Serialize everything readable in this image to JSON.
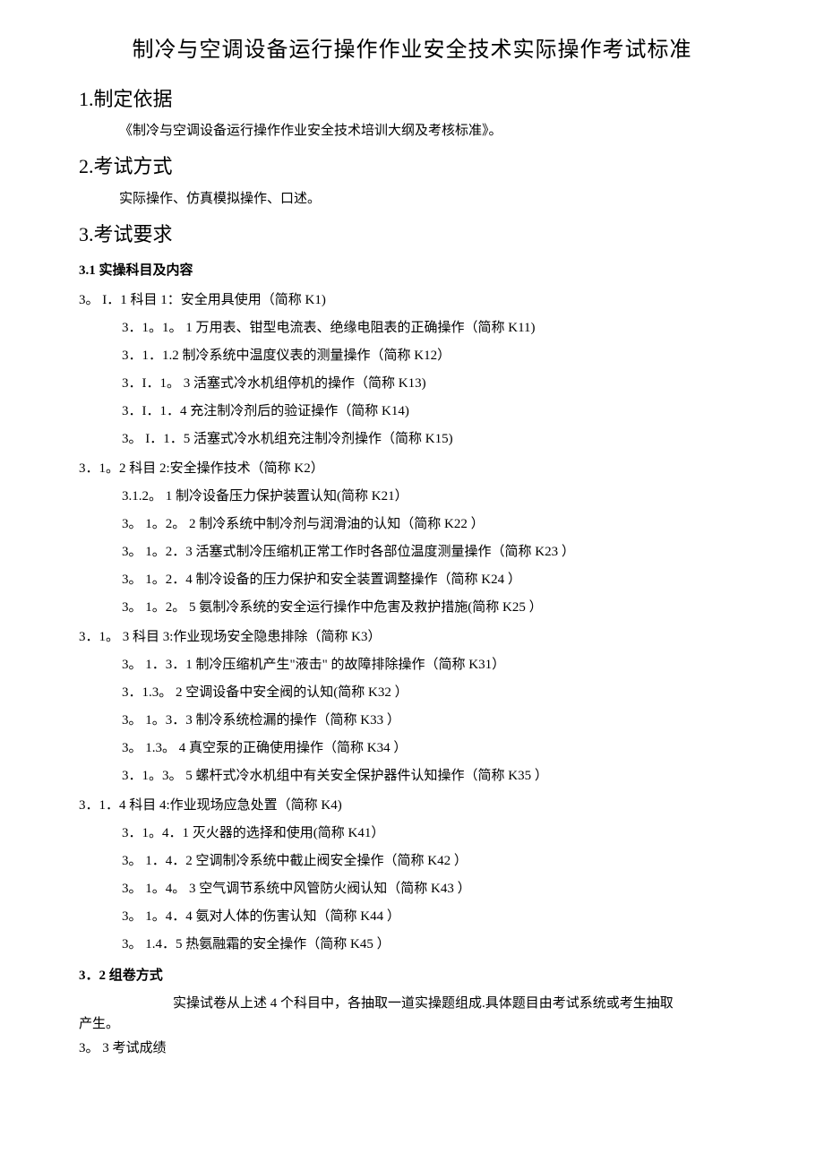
{
  "title": "制冷与空调设备运行操作作业安全技术实际操作考试标准",
  "sec1": {
    "heading": "1.制定依据",
    "body": "《制冷与空调设备运行操作作业安全技术培训大纲及考核标准》。"
  },
  "sec2": {
    "heading": "2.考试方式",
    "body": "实际操作、仿真模拟操作、口述。"
  },
  "sec3": {
    "heading": "3.考试要求",
    "sub1": {
      "heading": "3.1 实操科目及内容",
      "k1": {
        "head": "3。 I．1 科目 1：安全用具使用（简称 K1)",
        "i1": "3．1。1。 1 万用表、钳型电流表、绝缘电阻表的正确操作（简称 K11)",
        "i2": "3．1．1.2 制冷系统中温度仪表的测量操作（简称 K12）",
        "i3": "3．I．1。 3 活塞式冷水机组停机的操作（简称 K13)",
        "i4": "3．I．1．4 充注制冷剂后的验证操作（简称 K14)",
        "i5": "3。 I．1．5 活塞式冷水机组充注制冷剂操作（简称 K15)"
      },
      "k2": {
        "head": "3．1。2 科目 2:安全操作技术（简称 K2）",
        "i1": "3.1.2。 1 制冷设备压力保护装置认知(简称 K21）",
        "i2": "3。 1。2。 2 制冷系统中制冷剂与润滑油的认知（简称 K22 ）",
        "i3": "3。 1。2．3 活塞式制冷压缩机正常工作时各部位温度测量操作（简称 K23 ）",
        "i4": "3。 1。2．4 制冷设备的压力保护和安全装置调整操作（简称 K24 ）",
        "i5": "3。 1。2。 5 氨制冷系统的安全运行操作中危害及救护措施(简称 K25 ）"
      },
      "k3": {
        "head": "3．1。 3 科目 3:作业现场安全隐患排除（简称 K3）",
        "i1": "3。 1．3．1 制冷压缩机产生\"液击\" 的故障排除操作（简称 K31）",
        "i2": "3．1.3。 2 空调设备中安全阀的认知(简称 K32 ）",
        "i3": "3。 1。3．3 制冷系统检漏的操作（简称 K33 ）",
        "i4": "3。 1.3。 4 真空泵的正确使用操作（简称 K34 ）",
        "i5": "3．1。3。 5 螺杆式冷水机组中有关安全保护器件认知操作（简称 K35 ）"
      },
      "k4": {
        "head": "3．1．4 科目 4:作业现场应急处置（简称 K4)",
        "i1": "3．1。4．1 灭火器的选择和使用(简称 K41）",
        "i2": "3。 1．4．2 空调制冷系统中截止阀安全操作（简称 K42 ）",
        "i3": "3。 1。4。 3 空气调节系统中风管防火阀认知（简称 K43 ）",
        "i4": "3。 1。4．4 氨对人体的伤害认知（简称 K44 ）",
        "i5": "3。 1.4．5 热氨融霜的安全操作（简称 K45 ）"
      }
    },
    "sub2": {
      "heading": "3．2 组卷方式",
      "line1": "实操试卷从上述 4 个科目中，各抽取一道实操题组成.具体题目由考试系统或考生抽取",
      "line2": "产生。"
    },
    "sub3": {
      "heading": "3。 3 考试成绩"
    }
  }
}
